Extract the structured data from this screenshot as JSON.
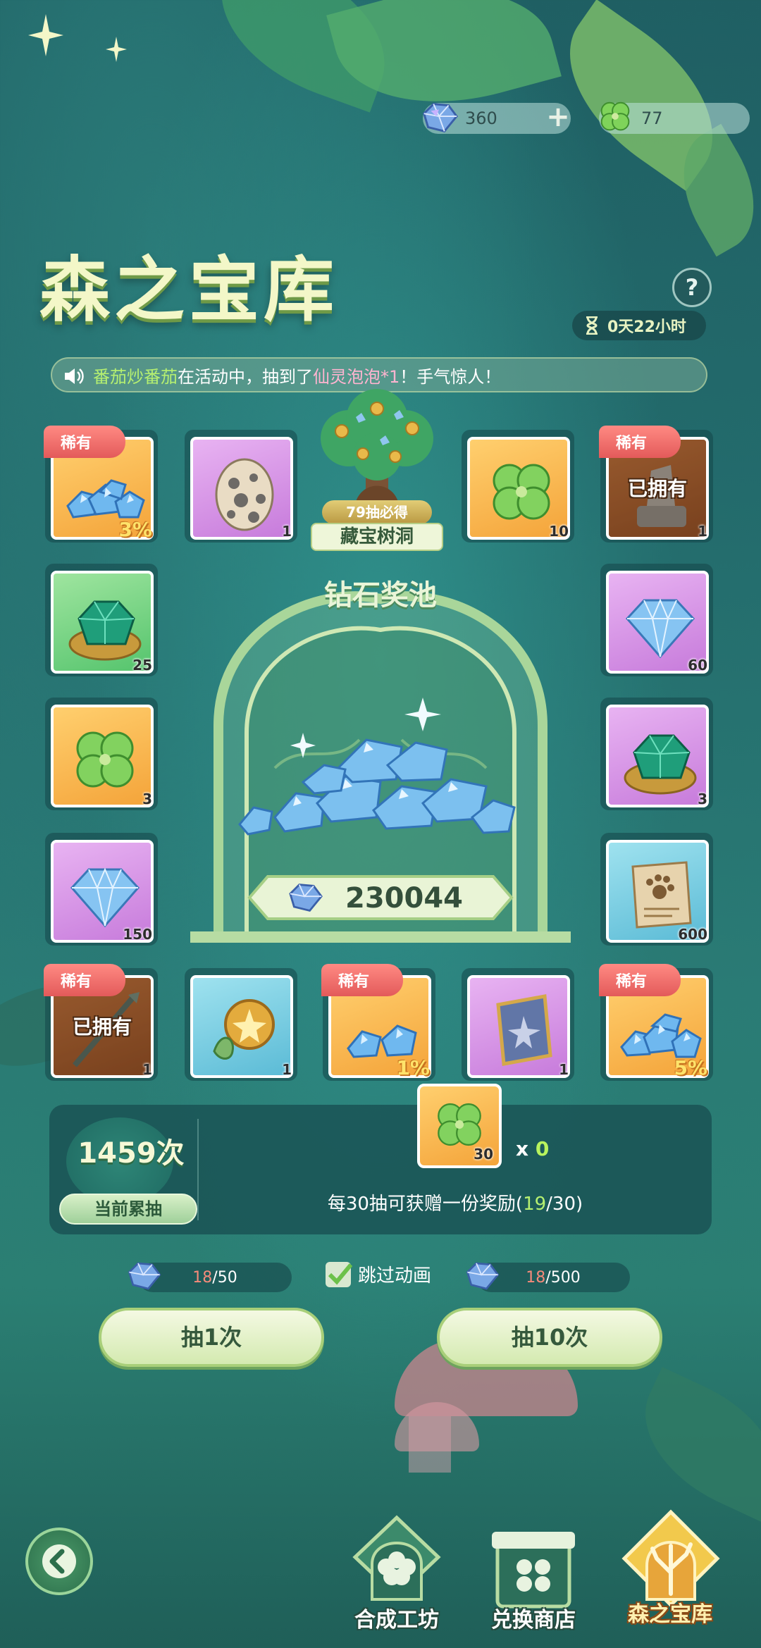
{
  "currencies": {
    "gems": "360",
    "clovers": "77"
  },
  "header": {
    "title": "森之宝库",
    "help": "?",
    "timer": "0天22小时"
  },
  "marquee": {
    "player": "番茄炒番茄",
    "text_mid": "在活动中，抽到了",
    "item": "仙灵泡泡*1",
    "text_end": "！手气惊人！"
  },
  "labels": {
    "rare": "稀有",
    "owned": "已拥有"
  },
  "grid": {
    "r1c1": {
      "qty": "3%",
      "rare": true
    },
    "r1c2": {
      "qty": "1"
    },
    "r1c4": {
      "qty": "10"
    },
    "r1c5": {
      "qty": "1",
      "rare": true,
      "owned": true
    },
    "r2c1": {
      "qty": "25"
    },
    "r2c5": {
      "qty": "60"
    },
    "r3c1": {
      "qty": "3"
    },
    "r3c5": {
      "qty": "3"
    },
    "r4c1": {
      "qty": "150"
    },
    "r4c5": {
      "qty": "600"
    },
    "r5c1": {
      "qty": "1",
      "rare": true,
      "owned": true
    },
    "r5c2": {
      "qty": "1"
    },
    "r5c3": {
      "qty": "1%",
      "rare": true
    },
    "r5c4": {
      "qty": "1"
    },
    "r5c5": {
      "qty": "5%",
      "rare": true
    }
  },
  "treasure_tree": {
    "guarantee": "79抽必得",
    "name": "藏宝树洞"
  },
  "pool": {
    "title": "钻石奖池",
    "amount": "230044"
  },
  "stats": {
    "count": "1459次",
    "count_label": "当前累抽",
    "reward_qty": "30",
    "reward_x": "x ",
    "reward_x_val": "0",
    "note_prefix": "每30抽可获赠一份奖励(",
    "note_current": "19",
    "note_suffix": "/30)"
  },
  "costs": {
    "single_have": "18",
    "single_need": "/50",
    "ten_have": "18",
    "ten_need": "/500"
  },
  "skip_animation": "跳过动画",
  "buttons": {
    "draw_one": "抽1次",
    "draw_ten": "抽10次"
  },
  "nav": {
    "craft": "合成工坊",
    "shop": "兑换商店",
    "vault": "森之宝库"
  },
  "colors": {
    "accent_green": "#b6f070",
    "rare_red": "#e35a5a",
    "active_gold": "#fff0b0"
  },
  "icons": [
    "gem-icon",
    "clover-icon",
    "plus-icon",
    "help-icon",
    "hourglass-icon",
    "speaker-icon",
    "check-icon",
    "back-arrow-icon",
    "tree-icon"
  ]
}
